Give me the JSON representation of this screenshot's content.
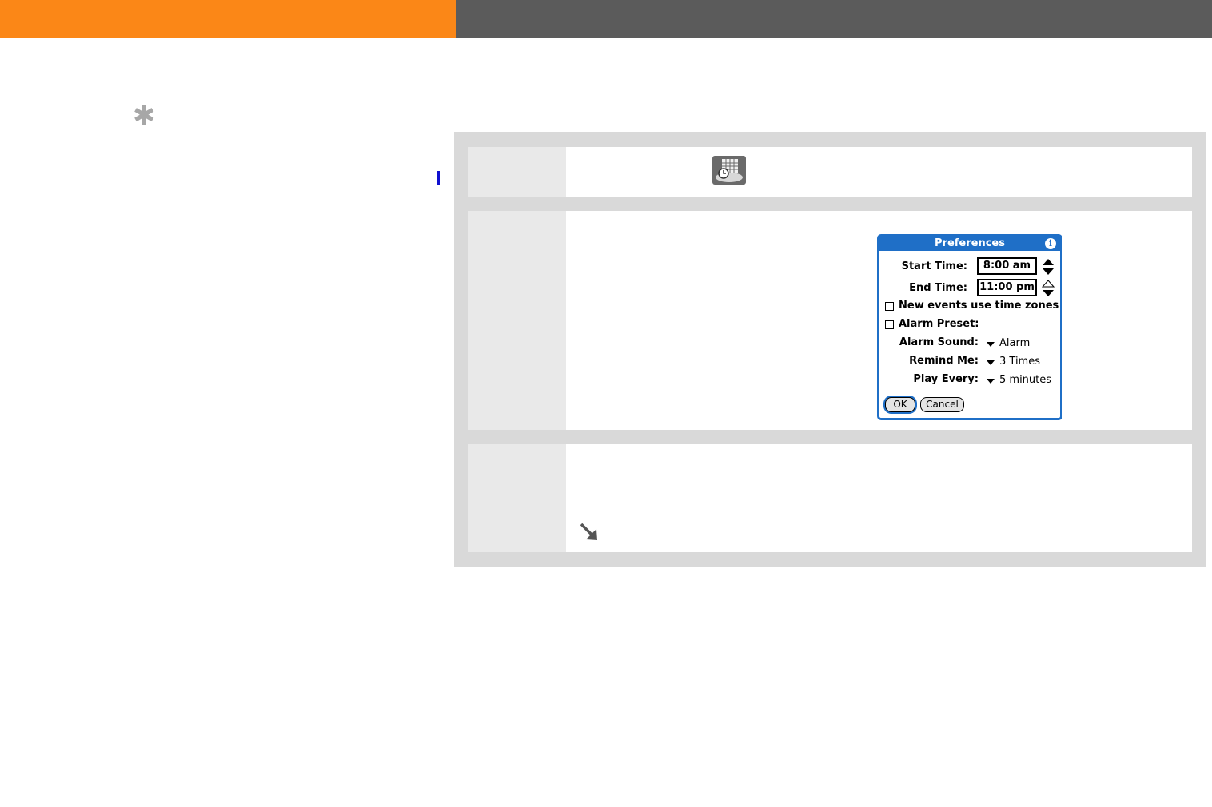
{
  "header": {
    "left_color": "#fb8717",
    "right_color": "#5b5b5b"
  },
  "sidebar": {
    "tip_icon": "asterisk-icon",
    "marker_color": "#1010d0"
  },
  "steps": [
    {
      "icon": "calendar-clock-app-icon"
    },
    {
      "dialog": {
        "title": "Preferences",
        "info_icon": "info-icon",
        "start_time_label": "Start Time:",
        "start_time_value": "8:00 am",
        "end_time_label": "End Time:",
        "end_time_value": "11:00 pm",
        "time_zones_label": "New events use time zones",
        "alarm_preset_label": "Alarm Preset:",
        "alarm_sound_label": "Alarm Sound:",
        "alarm_sound_value": "Alarm",
        "remind_me_label": "Remind Me:",
        "remind_me_value": "3 Times",
        "play_every_label": "Play Every:",
        "play_every_value": "5 minutes",
        "ok_label": "OK",
        "cancel_label": "Cancel",
        "accent_color": "#1f6fc7"
      }
    },
    {
      "icon": "continue-arrow-icon"
    }
  ]
}
